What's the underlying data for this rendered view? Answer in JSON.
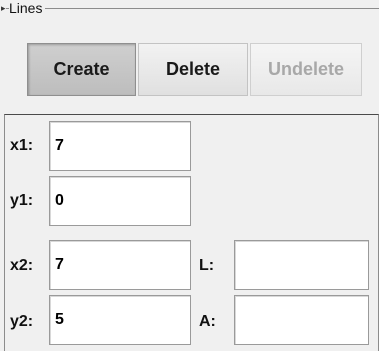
{
  "group": {
    "title": "Lines",
    "collapse_icon": "collapse-arrow-icon"
  },
  "buttons": {
    "create": "Create",
    "delete": "Delete",
    "undelete": "Undelete"
  },
  "fields": {
    "x1": {
      "label": "x1:",
      "value": "7"
    },
    "y1": {
      "label": "y1:",
      "value": "0"
    },
    "x2": {
      "label": "x2:",
      "value": "7"
    },
    "y2": {
      "label": "y2:",
      "value": "5"
    },
    "L": {
      "label": "L:",
      "value": ""
    },
    "A": {
      "label": "A:",
      "value": ""
    }
  },
  "colors": {
    "background": "#f0f0f0",
    "disabled_text": "#a8a8a8"
  }
}
